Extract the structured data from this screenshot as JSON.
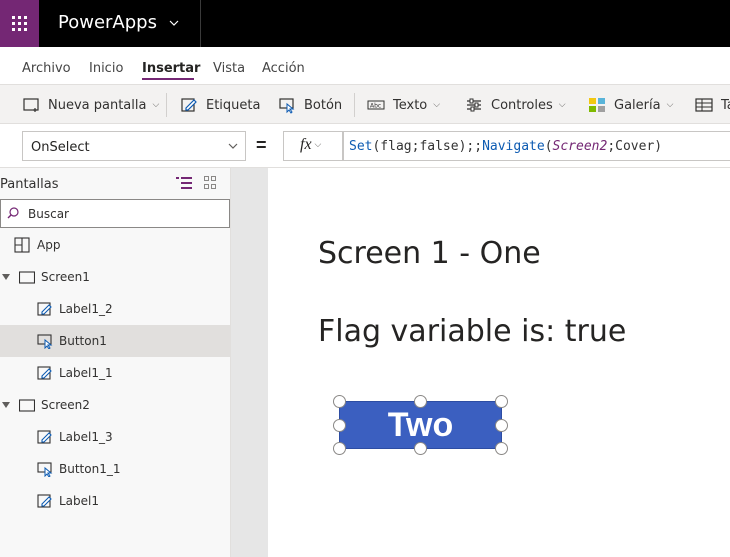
{
  "app": {
    "name": "PowerApps"
  },
  "menu": {
    "tabs": [
      "Archivo",
      "Inicio",
      "Insertar",
      "Vista",
      "Acción"
    ],
    "active": "Insertar"
  },
  "ribbon": {
    "new_screen": "Nueva pantalla",
    "label": "Etiqueta",
    "button": "Botón",
    "text": "Texto",
    "controls": "Controles",
    "gallery": "Galería",
    "table": "Ta"
  },
  "formula_bar": {
    "property": "OnSelect",
    "equals": "=",
    "fx": "fx",
    "f_set": "Set",
    "f_args1": "(flag;false);;",
    "f_navigate": "Navigate",
    "f_paren_open": "(",
    "f_screen2": "Screen2",
    "f_args2": ";Cover)"
  },
  "tree": {
    "title": "Pantallas",
    "search_placeholder": "Buscar",
    "items": [
      {
        "label": "App",
        "kind": "app-icon"
      },
      {
        "label": "Screen1",
        "kind": "screen-icon",
        "expanded": true
      },
      {
        "label": "Label1_2",
        "kind": "label-icon"
      },
      {
        "label": "Button1",
        "kind": "button-icon",
        "selected": true
      },
      {
        "label": "Label1_1",
        "kind": "label-icon"
      },
      {
        "label": "Screen2",
        "kind": "screen-icon",
        "expanded": true
      },
      {
        "label": "Label1_3",
        "kind": "label-icon"
      },
      {
        "label": "Button1_1",
        "kind": "button-icon"
      },
      {
        "label": "Label1",
        "kind": "label-icon"
      }
    ]
  },
  "canvas": {
    "label1_text": "Screen 1 - One",
    "label2_text": "Flag variable is: true",
    "button_text": "Two",
    "button_color": "#3b5fc0"
  },
  "colors": {
    "brand": "#742774",
    "topbar": "#000000",
    "accent_blue": "#0d5bb2"
  }
}
